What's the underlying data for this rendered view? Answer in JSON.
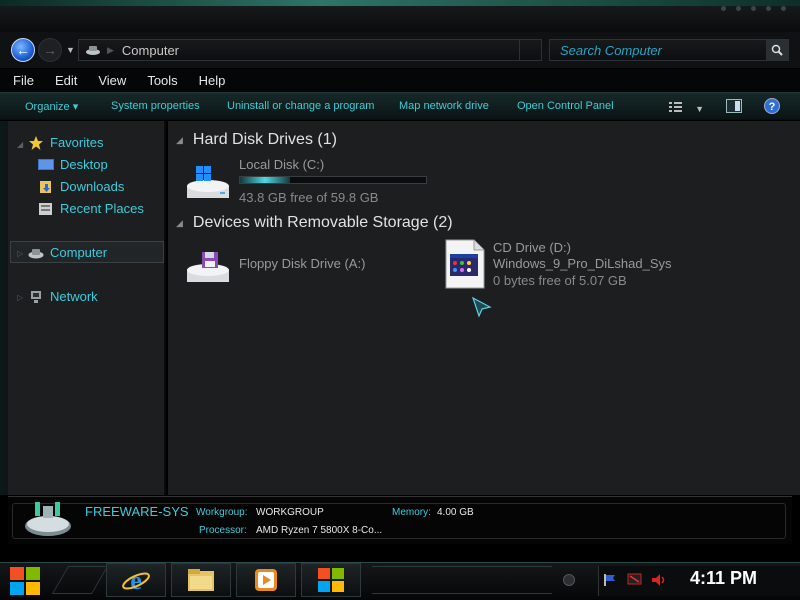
{
  "window": {
    "title": "Computer"
  },
  "address": {
    "location": "Computer",
    "search_placeholder": "Search Computer"
  },
  "menu": [
    "File",
    "Edit",
    "View",
    "Tools",
    "Help"
  ],
  "commands": {
    "organize": "Organize",
    "system_properties": "System properties",
    "uninstall": "Uninstall or change a program",
    "map_network": "Map network drive",
    "control_panel": "Open Control Panel"
  },
  "sidebar": {
    "favorites": "Favorites",
    "desktop": "Desktop",
    "downloads": "Downloads",
    "recent": "Recent Places",
    "computer": "Computer",
    "network": "Network"
  },
  "groups": {
    "hdd": {
      "title": "Hard Disk Drives (1)"
    },
    "removable": {
      "title": "Devices with Removable Storage (2)"
    }
  },
  "drives": {
    "c": {
      "name": "Local Disk (C:)",
      "free_text": "43.8 GB free of 59.8 GB",
      "used_fraction": 0.27
    },
    "floppy": {
      "name": "Floppy Disk Drive (A:)"
    },
    "cd": {
      "name": "CD Drive (D:)",
      "label": "Windows_9_Pro_DiLshad_Sys",
      "free_text": "0 bytes free of 5.07 GB"
    }
  },
  "details": {
    "computer_name": "FREEWARE-SYS",
    "workgroup_label": "Workgroup:",
    "workgroup_value": "WORKGROUP",
    "memory_label": "Memory:",
    "memory_value": "4.00 GB",
    "processor_label": "Processor:",
    "processor_value": "AMD Ryzen 7 5800X 8-Co..."
  },
  "taskbar": {
    "apps": [
      "internet-explorer-icon",
      "file-explorer-icon",
      "media-player-icon",
      "store-icon"
    ],
    "clock": "4:11 PM"
  },
  "colors": {
    "accent": "#3ecbdc",
    "background": "#1c1e20"
  }
}
